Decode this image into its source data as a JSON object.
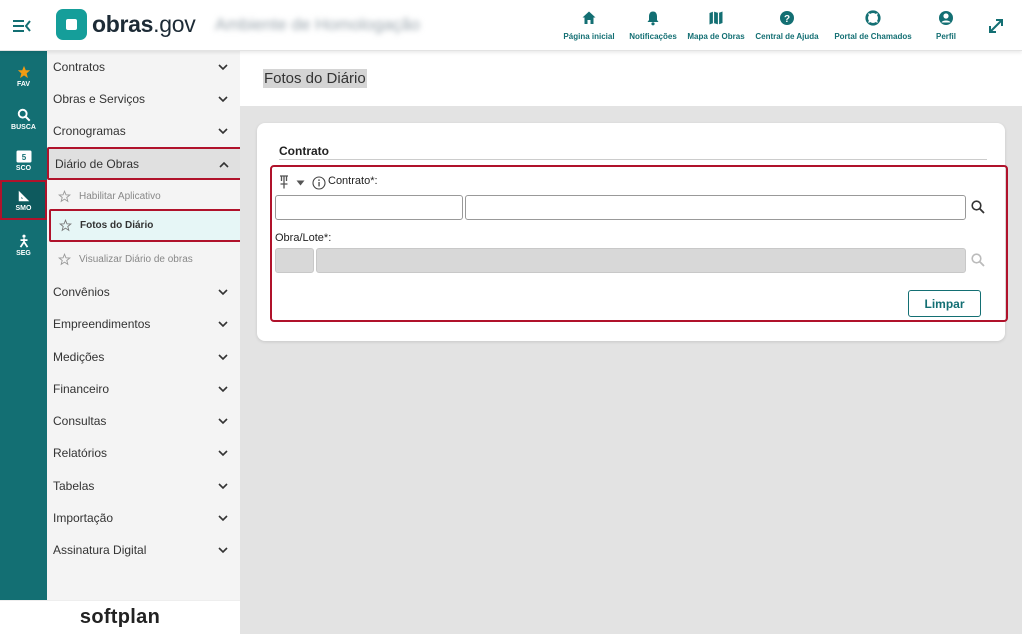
{
  "header": {
    "logo_bold": "obras",
    "logo_rest": ".gov",
    "environment": "Ambiente de Homologação",
    "nav": [
      {
        "label": "Página inicial",
        "icon": "home-icon"
      },
      {
        "label": "Notificações",
        "icon": "bell-icon"
      },
      {
        "label": "Mapa de Obras",
        "icon": "map-icon"
      },
      {
        "label": "Central de Ajuda",
        "icon": "help-icon"
      },
      {
        "label": "Portal de Chamados",
        "icon": "lifebuoy-icon"
      },
      {
        "label": "Perfil",
        "icon": "user-icon"
      }
    ]
  },
  "rail": {
    "items": [
      {
        "label": "FAV",
        "icon": "star-icon"
      },
      {
        "label": "BUSCA",
        "icon": "search-icon"
      },
      {
        "label": "SCO",
        "icon": "sco-icon"
      },
      {
        "label": "SMO",
        "icon": "ruler-icon"
      },
      {
        "label": "SEG",
        "icon": "person-icon"
      }
    ]
  },
  "sidebar": {
    "items": [
      {
        "label": "Contratos"
      },
      {
        "label": "Obras e Serviços"
      },
      {
        "label": "Cronogramas"
      },
      {
        "label": "Diário de Obras"
      },
      {
        "label": "Convênios"
      },
      {
        "label": "Empreendimentos"
      },
      {
        "label": "Medições"
      },
      {
        "label": "Financeiro"
      },
      {
        "label": "Consultas"
      },
      {
        "label": "Relatórios"
      },
      {
        "label": "Tabelas"
      },
      {
        "label": "Importação"
      },
      {
        "label": "Assinatura Digital"
      }
    ],
    "sub_items": [
      {
        "label": "Habilitar Aplicativo"
      },
      {
        "label": "Fotos do Diário"
      },
      {
        "label": "Visualizar Diário de obras"
      }
    ],
    "footer_brand": "softplan"
  },
  "main": {
    "page_title": "Fotos do Diário",
    "section_title": "Contrato",
    "contrato_label": "Contrato*:",
    "obra_label": "Obra/Lote*:",
    "contrato_code": "",
    "contrato_desc": "",
    "obra_code": "",
    "obra_desc": "",
    "clear_button": "Limpar"
  },
  "colors": {
    "brand_teal": "#136f73",
    "highlight_red": "#b0122b",
    "fav_orange": "#f39c12"
  }
}
